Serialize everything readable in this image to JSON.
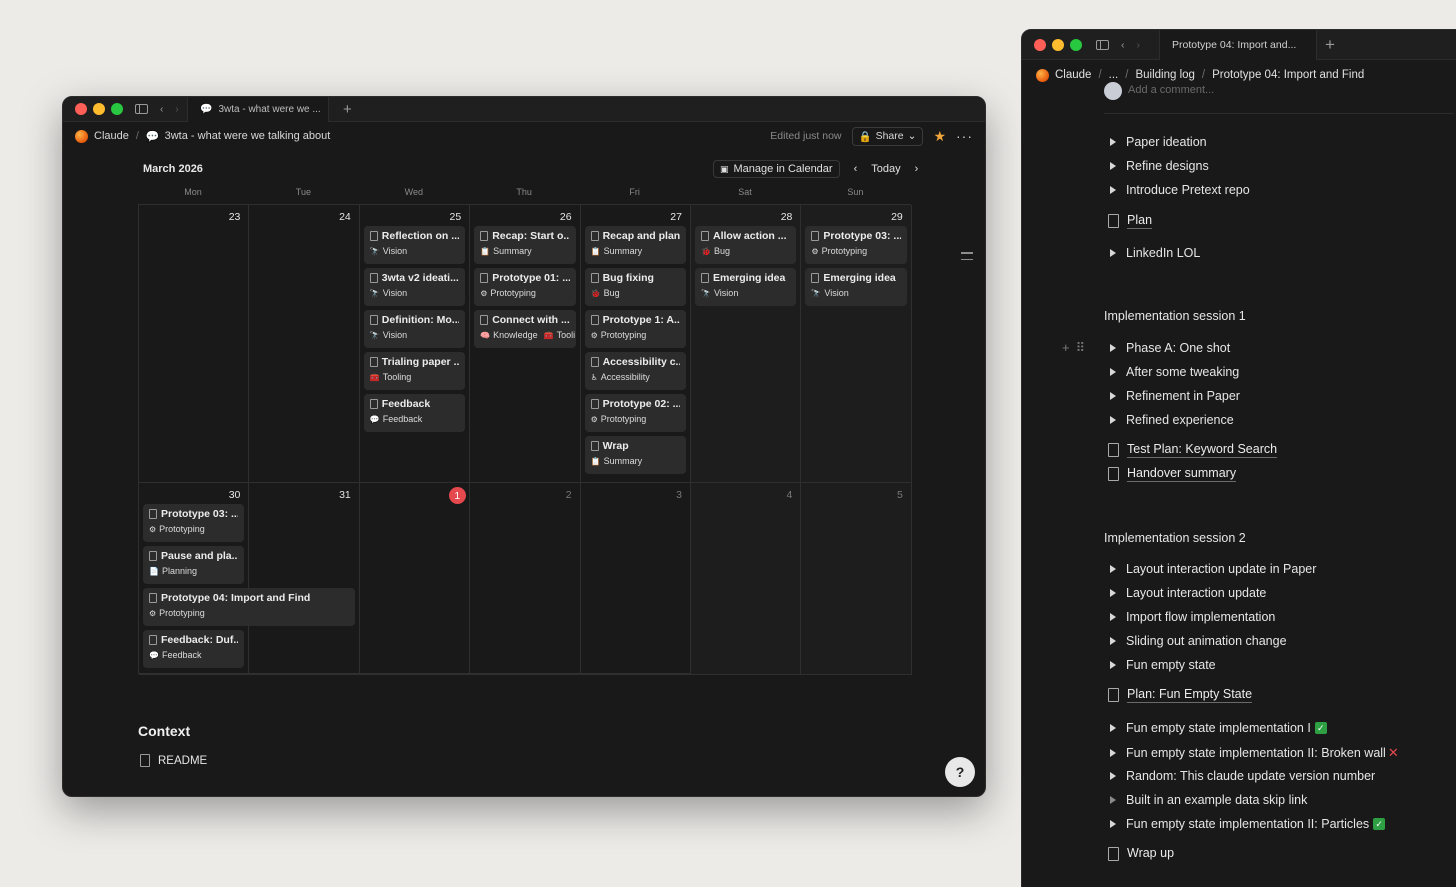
{
  "left_window": {
    "tab_title": "3wta - what were we ...",
    "breadcrumb": {
      "workspace": "Claude",
      "page": "3wta - what were we talking about"
    },
    "edited_status": "Edited just now",
    "share_label": "Share",
    "calendar": {
      "month_label": "March 2026",
      "manage_label": "Manage in Calendar",
      "today_label": "Today",
      "weekdays": [
        "Mon",
        "Tue",
        "Wed",
        "Thu",
        "Fri",
        "Sat",
        "Sun"
      ],
      "week1_days": [
        "23",
        "24",
        "25",
        "26",
        "27",
        "28",
        "29"
      ],
      "week2_days": [
        "30",
        "31",
        "1",
        "2",
        "3",
        "4",
        "5"
      ],
      "events": {
        "wed25": [
          {
            "title": "Reflection on ...",
            "tag": "Vision"
          },
          {
            "title": "3wta v2 ideati...",
            "tag": "Vision"
          },
          {
            "title": "Definition: Mo...",
            "tag": "Vision"
          },
          {
            "title": "Trialing paper ...",
            "tag": "Tooling"
          },
          {
            "title": "Feedback",
            "tag": "Feedback"
          }
        ],
        "thu26": [
          {
            "title": "Recap: Start o...",
            "tag": "Summary"
          },
          {
            "title": "Prototype 01: ...",
            "tag": "Prototyping"
          },
          {
            "title": "Connect with ...",
            "tag": "Knowledge",
            "tag2": "Tooli"
          }
        ],
        "fri27": [
          {
            "title": "Recap and plan",
            "tag": "Summary"
          },
          {
            "title": "Bug fixing",
            "tag": "Bug"
          },
          {
            "title": "Prototype 1: A...",
            "tag": "Prototyping"
          },
          {
            "title": "Accessibility c...",
            "tag": "Accessibility"
          },
          {
            "title": "Prototype 02: ...",
            "tag": "Prototyping"
          },
          {
            "title": "Wrap",
            "tag": "Summary"
          }
        ],
        "sat28": [
          {
            "title": "Allow action ...",
            "tag": "Bug"
          },
          {
            "title": "Emerging idea",
            "tag": "Vision"
          }
        ],
        "sun29": [
          {
            "title": "Prototype 03: ...",
            "tag": "Prototyping"
          },
          {
            "title": "Emerging idea",
            "tag": "Vision"
          }
        ],
        "mon30": [
          {
            "title": "Prototype 03: ...",
            "tag": "Prototyping"
          },
          {
            "title": "Pause and pla...",
            "tag": "Planning"
          },
          {
            "title": "Prototype 04: Import and Find",
            "tag": "Prototyping"
          },
          {
            "title": "Feedback: Duf...",
            "tag": "Feedback"
          }
        ]
      }
    },
    "context_heading": "Context",
    "readme_label": "README",
    "help_label": "?"
  },
  "right_window": {
    "tab_title": "Prototype 04: Import and...",
    "breadcrumb": {
      "workspace": "Claude",
      "ellipsis": "...",
      "parent": "Building log",
      "page": "Prototype 04: Import and Find"
    },
    "comment_placeholder": "Add a comment...",
    "items_top": [
      "Paper ideation",
      "Refine designs",
      "Introduce Pretext repo"
    ],
    "page_plan": "Plan",
    "item_linkedin": "LinkedIn LOL",
    "session1_heading": "Implementation session 1",
    "session1_items": [
      "Phase A: One shot",
      "After some tweaking",
      "Refinement in Paper",
      "Refined experience"
    ],
    "page_test_plan": "Test Plan: Keyword Search",
    "page_handover": "Handover summary",
    "session2_heading": "Implementation session 2",
    "session2_items": [
      "Layout interaction update in Paper",
      "Layout interaction update",
      "Import flow implementation",
      "Sliding out animation change",
      "Fun empty state"
    ],
    "page_plan_fun": "Plan: Fun Empty State",
    "session2b_items": [
      "Fun empty state implementation I",
      "Fun empty state implementation II: Broken wall",
      "Random: This claude update version number",
      "Built in an example data skip link",
      "Fun empty state implementation II: Particles"
    ],
    "page_wrap": "Wrap up"
  },
  "tag_emoji": {
    "Vision": "🔭",
    "Tooling": "🧰",
    "Feedback": "💬",
    "Summary": "📋",
    "Prototyping": "⚙",
    "Knowledge": "🧠",
    "Bug": "🐞",
    "Accessibility": "♿",
    "Planning": "📄"
  }
}
